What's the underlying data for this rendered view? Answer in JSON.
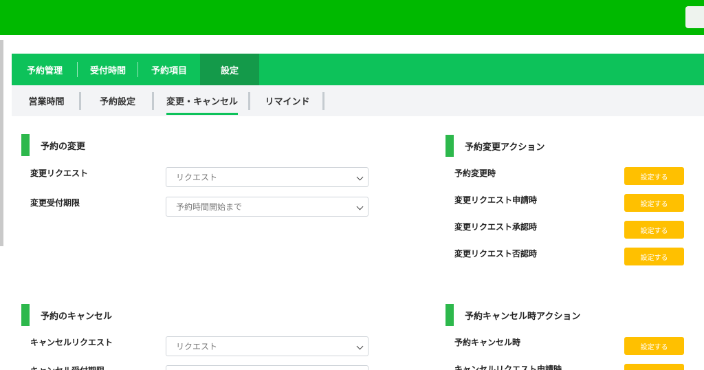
{
  "main_tabs": [
    {
      "label": "予約管理"
    },
    {
      "label": "受付時間"
    },
    {
      "label": "予約項目"
    },
    {
      "label": "設定"
    }
  ],
  "sub_tabs": [
    {
      "label": "営業時間"
    },
    {
      "label": "予約設定"
    },
    {
      "label": "変更・キャンセル"
    },
    {
      "label": "リマインド"
    }
  ],
  "change_section": {
    "title": "予約の変更",
    "fields": [
      {
        "label": "変更リクエスト",
        "value": "リクエスト"
      },
      {
        "label": "変更受付期限",
        "value": "予約時間開始まで"
      }
    ]
  },
  "change_actions": {
    "title": "予約変更アクション",
    "button_label": "設定する",
    "items": [
      {
        "label": "予約変更時"
      },
      {
        "label": "変更リクエスト申請時"
      },
      {
        "label": "変更リクエスト承認時"
      },
      {
        "label": "変更リクエスト否認時"
      }
    ]
  },
  "cancel_section": {
    "title": "予約のキャンセル",
    "fields": [
      {
        "label": "キャンセルリクエスト",
        "value": "リクエスト"
      },
      {
        "label": "キャンセル受付期限",
        "value": ""
      }
    ]
  },
  "cancel_actions": {
    "title": "予約キャンセル時アクション",
    "button_label": "設定する",
    "items": [
      {
        "label": "予約キャンセル時"
      },
      {
        "label": "キャンセルリクエスト申請時"
      }
    ]
  },
  "colors": {
    "header": "#00b900",
    "tab_bar": "#0dc25a",
    "tab_active": "#149a4a",
    "accent_button": "#ffc000"
  }
}
